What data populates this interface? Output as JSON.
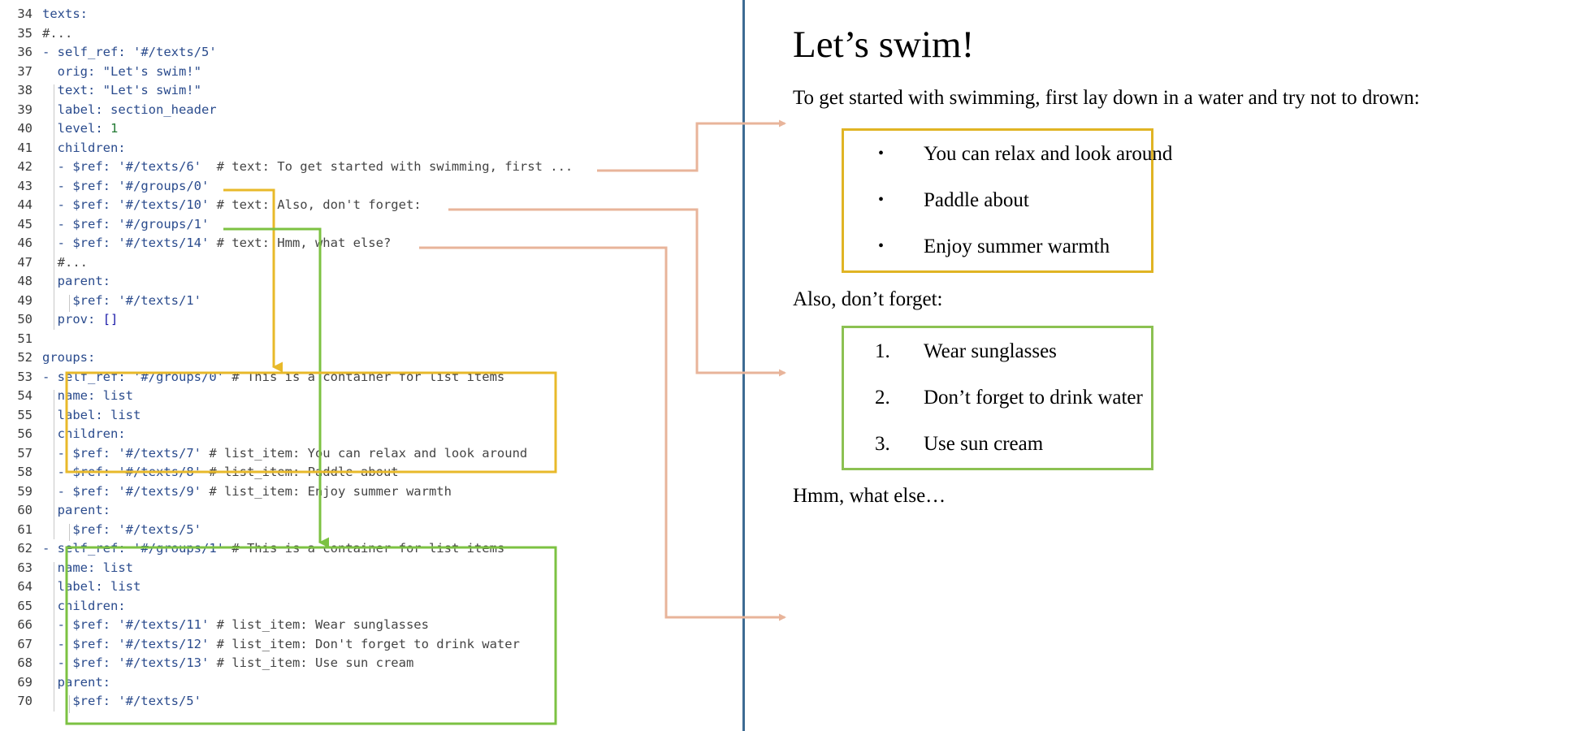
{
  "colors": {
    "divider": "#3d6b93",
    "connector": "#e8b49a",
    "yellow_box": "#e0b424",
    "green_box": "#8cc152",
    "code_key": "#2a4b8d",
    "code_comment": "#444444",
    "code_number": "#237a34",
    "line_number": "#3c3c3c"
  },
  "code": {
    "first_line_number": 34,
    "lines": [
      {
        "n": 34,
        "indent": 0,
        "tokens": [
          {
            "t": "texts:",
            "c": "k"
          }
        ]
      },
      {
        "n": 35,
        "indent": 0,
        "tokens": [
          {
            "t": "#...",
            "c": "cm"
          }
        ]
      },
      {
        "n": 36,
        "indent": 0,
        "tokens": [
          {
            "t": "- ",
            "c": "dash"
          },
          {
            "t": "self_ref: ",
            "c": "k"
          },
          {
            "t": "'#/texts/5'",
            "c": "s"
          }
        ]
      },
      {
        "n": 37,
        "indent": 1,
        "tokens": [
          {
            "t": "orig: ",
            "c": "k"
          },
          {
            "t": "\"Let's swim!\"",
            "c": "s"
          }
        ]
      },
      {
        "n": 38,
        "indent": 1,
        "tokens": [
          {
            "t": "text: ",
            "c": "k"
          },
          {
            "t": "\"Let's swim!\"",
            "c": "s"
          }
        ]
      },
      {
        "n": 39,
        "indent": 1,
        "tokens": [
          {
            "t": "label: ",
            "c": "k"
          },
          {
            "t": "section_header",
            "c": "s"
          }
        ]
      },
      {
        "n": 40,
        "indent": 1,
        "tokens": [
          {
            "t": "level: ",
            "c": "k"
          },
          {
            "t": "1",
            "c": "num"
          }
        ]
      },
      {
        "n": 41,
        "indent": 1,
        "tokens": [
          {
            "t": "children:",
            "c": "k"
          }
        ]
      },
      {
        "n": 42,
        "indent": 1,
        "tokens": [
          {
            "t": "- ",
            "c": "dash"
          },
          {
            "t": "$ref: ",
            "c": "k"
          },
          {
            "t": "'#/texts/6'",
            "c": "s"
          },
          {
            "t": "  # text: To get started with swimming, first ...",
            "c": "cm"
          }
        ]
      },
      {
        "n": 43,
        "indent": 1,
        "tokens": [
          {
            "t": "- ",
            "c": "dash"
          },
          {
            "t": "$ref: ",
            "c": "k"
          },
          {
            "t": "'#/groups/0'",
            "c": "s"
          }
        ]
      },
      {
        "n": 44,
        "indent": 1,
        "tokens": [
          {
            "t": "- ",
            "c": "dash"
          },
          {
            "t": "$ref: ",
            "c": "k"
          },
          {
            "t": "'#/texts/10'",
            "c": "s"
          },
          {
            "t": " # text: Also, don't forget:",
            "c": "cm"
          }
        ]
      },
      {
        "n": 45,
        "indent": 1,
        "tokens": [
          {
            "t": "- ",
            "c": "dash"
          },
          {
            "t": "$ref: ",
            "c": "k"
          },
          {
            "t": "'#/groups/1'",
            "c": "s"
          }
        ]
      },
      {
        "n": 46,
        "indent": 1,
        "tokens": [
          {
            "t": "- ",
            "c": "dash"
          },
          {
            "t": "$ref: ",
            "c": "k"
          },
          {
            "t": "'#/texts/14'",
            "c": "s"
          },
          {
            "t": " # text: Hmm, what else?",
            "c": "cm"
          }
        ]
      },
      {
        "n": 47,
        "indent": 1,
        "tokens": [
          {
            "t": "#...",
            "c": "cm"
          }
        ]
      },
      {
        "n": 48,
        "indent": 1,
        "tokens": [
          {
            "t": "parent:",
            "c": "k"
          }
        ]
      },
      {
        "n": 49,
        "indent": 2,
        "tokens": [
          {
            "t": "$ref: ",
            "c": "k"
          },
          {
            "t": "'#/texts/1'",
            "c": "s"
          }
        ]
      },
      {
        "n": 50,
        "indent": 1,
        "tokens": [
          {
            "t": "prov: ",
            "c": "k"
          },
          {
            "t": "[]",
            "c": "pun"
          }
        ]
      },
      {
        "n": 51,
        "indent": 0,
        "tokens": []
      },
      {
        "n": 52,
        "indent": 0,
        "tokens": [
          {
            "t": "groups:",
            "c": "k"
          }
        ]
      },
      {
        "n": 53,
        "indent": 0,
        "tokens": [
          {
            "t": "- ",
            "c": "dash"
          },
          {
            "t": "self_ref: ",
            "c": "k"
          },
          {
            "t": "'#/groups/0'",
            "c": "s"
          },
          {
            "t": " # This is a container for list items",
            "c": "cm"
          }
        ]
      },
      {
        "n": 54,
        "indent": 1,
        "tokens": [
          {
            "t": "name: ",
            "c": "k"
          },
          {
            "t": "list",
            "c": "s"
          }
        ]
      },
      {
        "n": 55,
        "indent": 1,
        "tokens": [
          {
            "t": "label: ",
            "c": "k"
          },
          {
            "t": "list",
            "c": "s"
          }
        ]
      },
      {
        "n": 56,
        "indent": 1,
        "tokens": [
          {
            "t": "children:",
            "c": "k"
          }
        ]
      },
      {
        "n": 57,
        "indent": 1,
        "tokens": [
          {
            "t": "- ",
            "c": "dash"
          },
          {
            "t": "$ref: ",
            "c": "k"
          },
          {
            "t": "'#/texts/7'",
            "c": "s"
          },
          {
            "t": " # list_item: You can relax and look around",
            "c": "cm"
          }
        ]
      },
      {
        "n": 58,
        "indent": 1,
        "tokens": [
          {
            "t": "- ",
            "c": "dash"
          },
          {
            "t": "$ref: ",
            "c": "k"
          },
          {
            "t": "'#/texts/8'",
            "c": "s"
          },
          {
            "t": " # list_item: Paddle about",
            "c": "cm"
          }
        ]
      },
      {
        "n": 59,
        "indent": 1,
        "tokens": [
          {
            "t": "- ",
            "c": "dash"
          },
          {
            "t": "$ref: ",
            "c": "k"
          },
          {
            "t": "'#/texts/9'",
            "c": "s"
          },
          {
            "t": " # list_item: Enjoy summer warmth",
            "c": "cm"
          }
        ]
      },
      {
        "n": 60,
        "indent": 1,
        "tokens": [
          {
            "t": "parent:",
            "c": "k"
          }
        ]
      },
      {
        "n": 61,
        "indent": 2,
        "tokens": [
          {
            "t": "$ref: ",
            "c": "k"
          },
          {
            "t": "'#/texts/5'",
            "c": "s"
          }
        ]
      },
      {
        "n": 62,
        "indent": 0,
        "tokens": [
          {
            "t": "- ",
            "c": "dash"
          },
          {
            "t": "self_ref: ",
            "c": "k"
          },
          {
            "t": "'#/groups/1'",
            "c": "s"
          },
          {
            "t": " # This is a container for list items",
            "c": "cm"
          }
        ]
      },
      {
        "n": 63,
        "indent": 1,
        "tokens": [
          {
            "t": "name: ",
            "c": "k"
          },
          {
            "t": "list",
            "c": "s"
          }
        ]
      },
      {
        "n": 64,
        "indent": 1,
        "tokens": [
          {
            "t": "label: ",
            "c": "k"
          },
          {
            "t": "list",
            "c": "s"
          }
        ]
      },
      {
        "n": 65,
        "indent": 1,
        "tokens": [
          {
            "t": "children:",
            "c": "k"
          }
        ]
      },
      {
        "n": 66,
        "indent": 1,
        "tokens": [
          {
            "t": "- ",
            "c": "dash"
          },
          {
            "t": "$ref: ",
            "c": "k"
          },
          {
            "t": "'#/texts/11'",
            "c": "s"
          },
          {
            "t": " # list_item: Wear sunglasses",
            "c": "cm"
          }
        ]
      },
      {
        "n": 67,
        "indent": 1,
        "tokens": [
          {
            "t": "- ",
            "c": "dash"
          },
          {
            "t": "$ref: ",
            "c": "k"
          },
          {
            "t": "'#/texts/12'",
            "c": "s"
          },
          {
            "t": " # list_item: Don't forget to drink water",
            "c": "cm"
          }
        ]
      },
      {
        "n": 68,
        "indent": 1,
        "tokens": [
          {
            "t": "- ",
            "c": "dash"
          },
          {
            "t": "$ref: ",
            "c": "k"
          },
          {
            "t": "'#/texts/13'",
            "c": "s"
          },
          {
            "t": " # list_item: Use sun cream",
            "c": "cm"
          }
        ]
      },
      {
        "n": 69,
        "indent": 1,
        "tokens": [
          {
            "t": "parent:",
            "c": "k"
          }
        ]
      },
      {
        "n": 70,
        "indent": 2,
        "tokens": [
          {
            "t": "$ref: ",
            "c": "k"
          },
          {
            "t": "'#/texts/5'",
            "c": "s"
          }
        ]
      }
    ]
  },
  "document": {
    "title": "Let’s swim!",
    "intro": "To get started with swimming, first lay down in a water and try not to drown:",
    "also": "Also, don’t forget:",
    "hmm": "Hmm, what else…",
    "bulleted_list": {
      "marker": "•",
      "items": [
        "You can relax and look around",
        "Paddle about",
        "Enjoy summer warmth"
      ]
    },
    "numbered_list": {
      "items": [
        {
          "marker": "1.",
          "text": "Wear sunglasses"
        },
        {
          "marker": "2.",
          "text": "Don’t forget to drink water"
        },
        {
          "marker": "3.",
          "text": "Use sun cream"
        }
      ]
    }
  }
}
